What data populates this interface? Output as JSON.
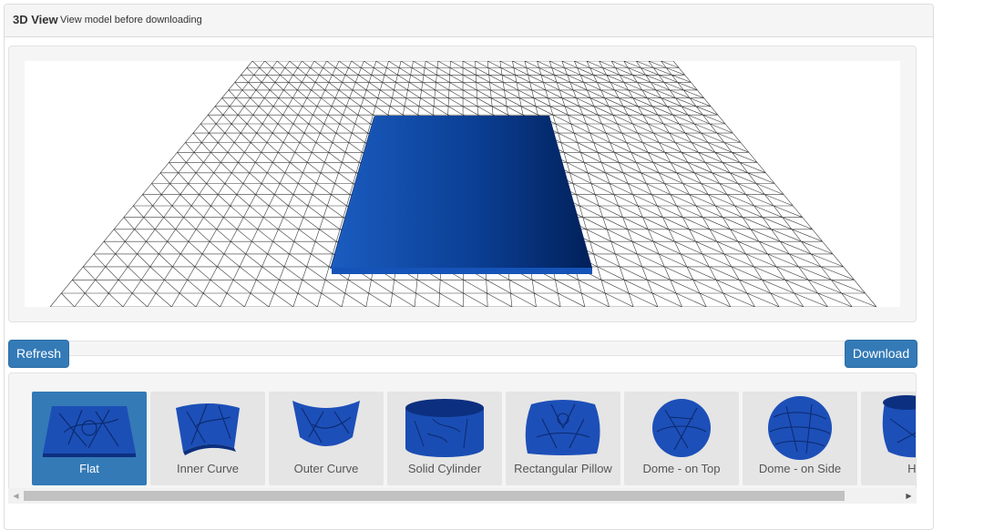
{
  "header": {
    "title": "3D View",
    "subtitle": "View model before downloading"
  },
  "toolbar": {
    "refresh_label": "Refresh",
    "download_label": "Download"
  },
  "viewer": {
    "model_color": "#0b4aa8",
    "grid_color": "#333333"
  },
  "shapes": {
    "selected": "Flat",
    "items": [
      {
        "label": "Flat",
        "icon": "flat-relief-icon"
      },
      {
        "label": "Inner Curve",
        "icon": "inner-curve-icon"
      },
      {
        "label": "Outer Curve",
        "icon": "outer-curve-icon"
      },
      {
        "label": "Solid Cylinder",
        "icon": "solid-cylinder-icon"
      },
      {
        "label": "Rectangular Pillow",
        "icon": "rectangular-pillow-icon"
      },
      {
        "label": "Dome - on Top",
        "icon": "dome-on-top-icon"
      },
      {
        "label": "Dome - on Side",
        "icon": "dome-on-side-icon"
      },
      {
        "label": "Hea",
        "icon": "heart-shape-icon"
      }
    ]
  },
  "colors": {
    "primary": "#337ab7",
    "well": "#f5f5f5"
  }
}
